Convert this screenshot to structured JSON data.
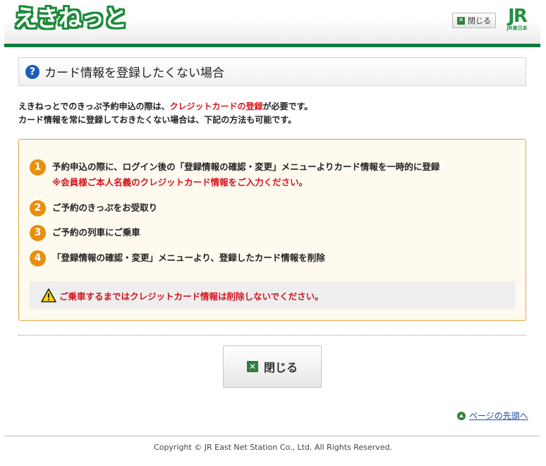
{
  "header": {
    "logo_text": "えきねっと",
    "close_label": "閉じる",
    "jr_mark": "JR",
    "jr_sub": "JR東日本"
  },
  "title": {
    "text": "カード情報を登録したくない場合"
  },
  "intro": {
    "line1_before": "えきねっとでのきっぷ予約申込の際は、",
    "line1_highlight": "クレジットカードの登録",
    "line1_after": "が必要です。",
    "line2": "カード情報を常に登録しておきたくない場合は、下記の方法も可能です。"
  },
  "steps": [
    {
      "num": "1",
      "text": "予約申込の際に、ログイン後の「登録情報の確認・変更」メニューよりカード情報を一時的に登録",
      "note": "※会員様ご本人名義のクレジットカード情報をご入力ください。"
    },
    {
      "num": "2",
      "text": "ご予約のきっぷをお受取り"
    },
    {
      "num": "3",
      "text": "ご予約の列車にご乗車"
    },
    {
      "num": "4",
      "text": "「登録情報の確認・変更」メニューより、登録したカード情報を削除"
    }
  ],
  "warning": {
    "text": "ご乗車するまではクレジットカード情報は削除しないでください。"
  },
  "close_button": {
    "label": "閉じる"
  },
  "page_top": {
    "label": "ページの先頭へ"
  },
  "footer": {
    "copyright": "Copyright © JR East Net Station Co., Ltd. All Rights Reserved."
  },
  "colors": {
    "brand_green": "#0f7a3c",
    "accent_orange": "#e88f0c",
    "alert_red": "#d4141e",
    "help_blue": "#1c5fb4"
  }
}
